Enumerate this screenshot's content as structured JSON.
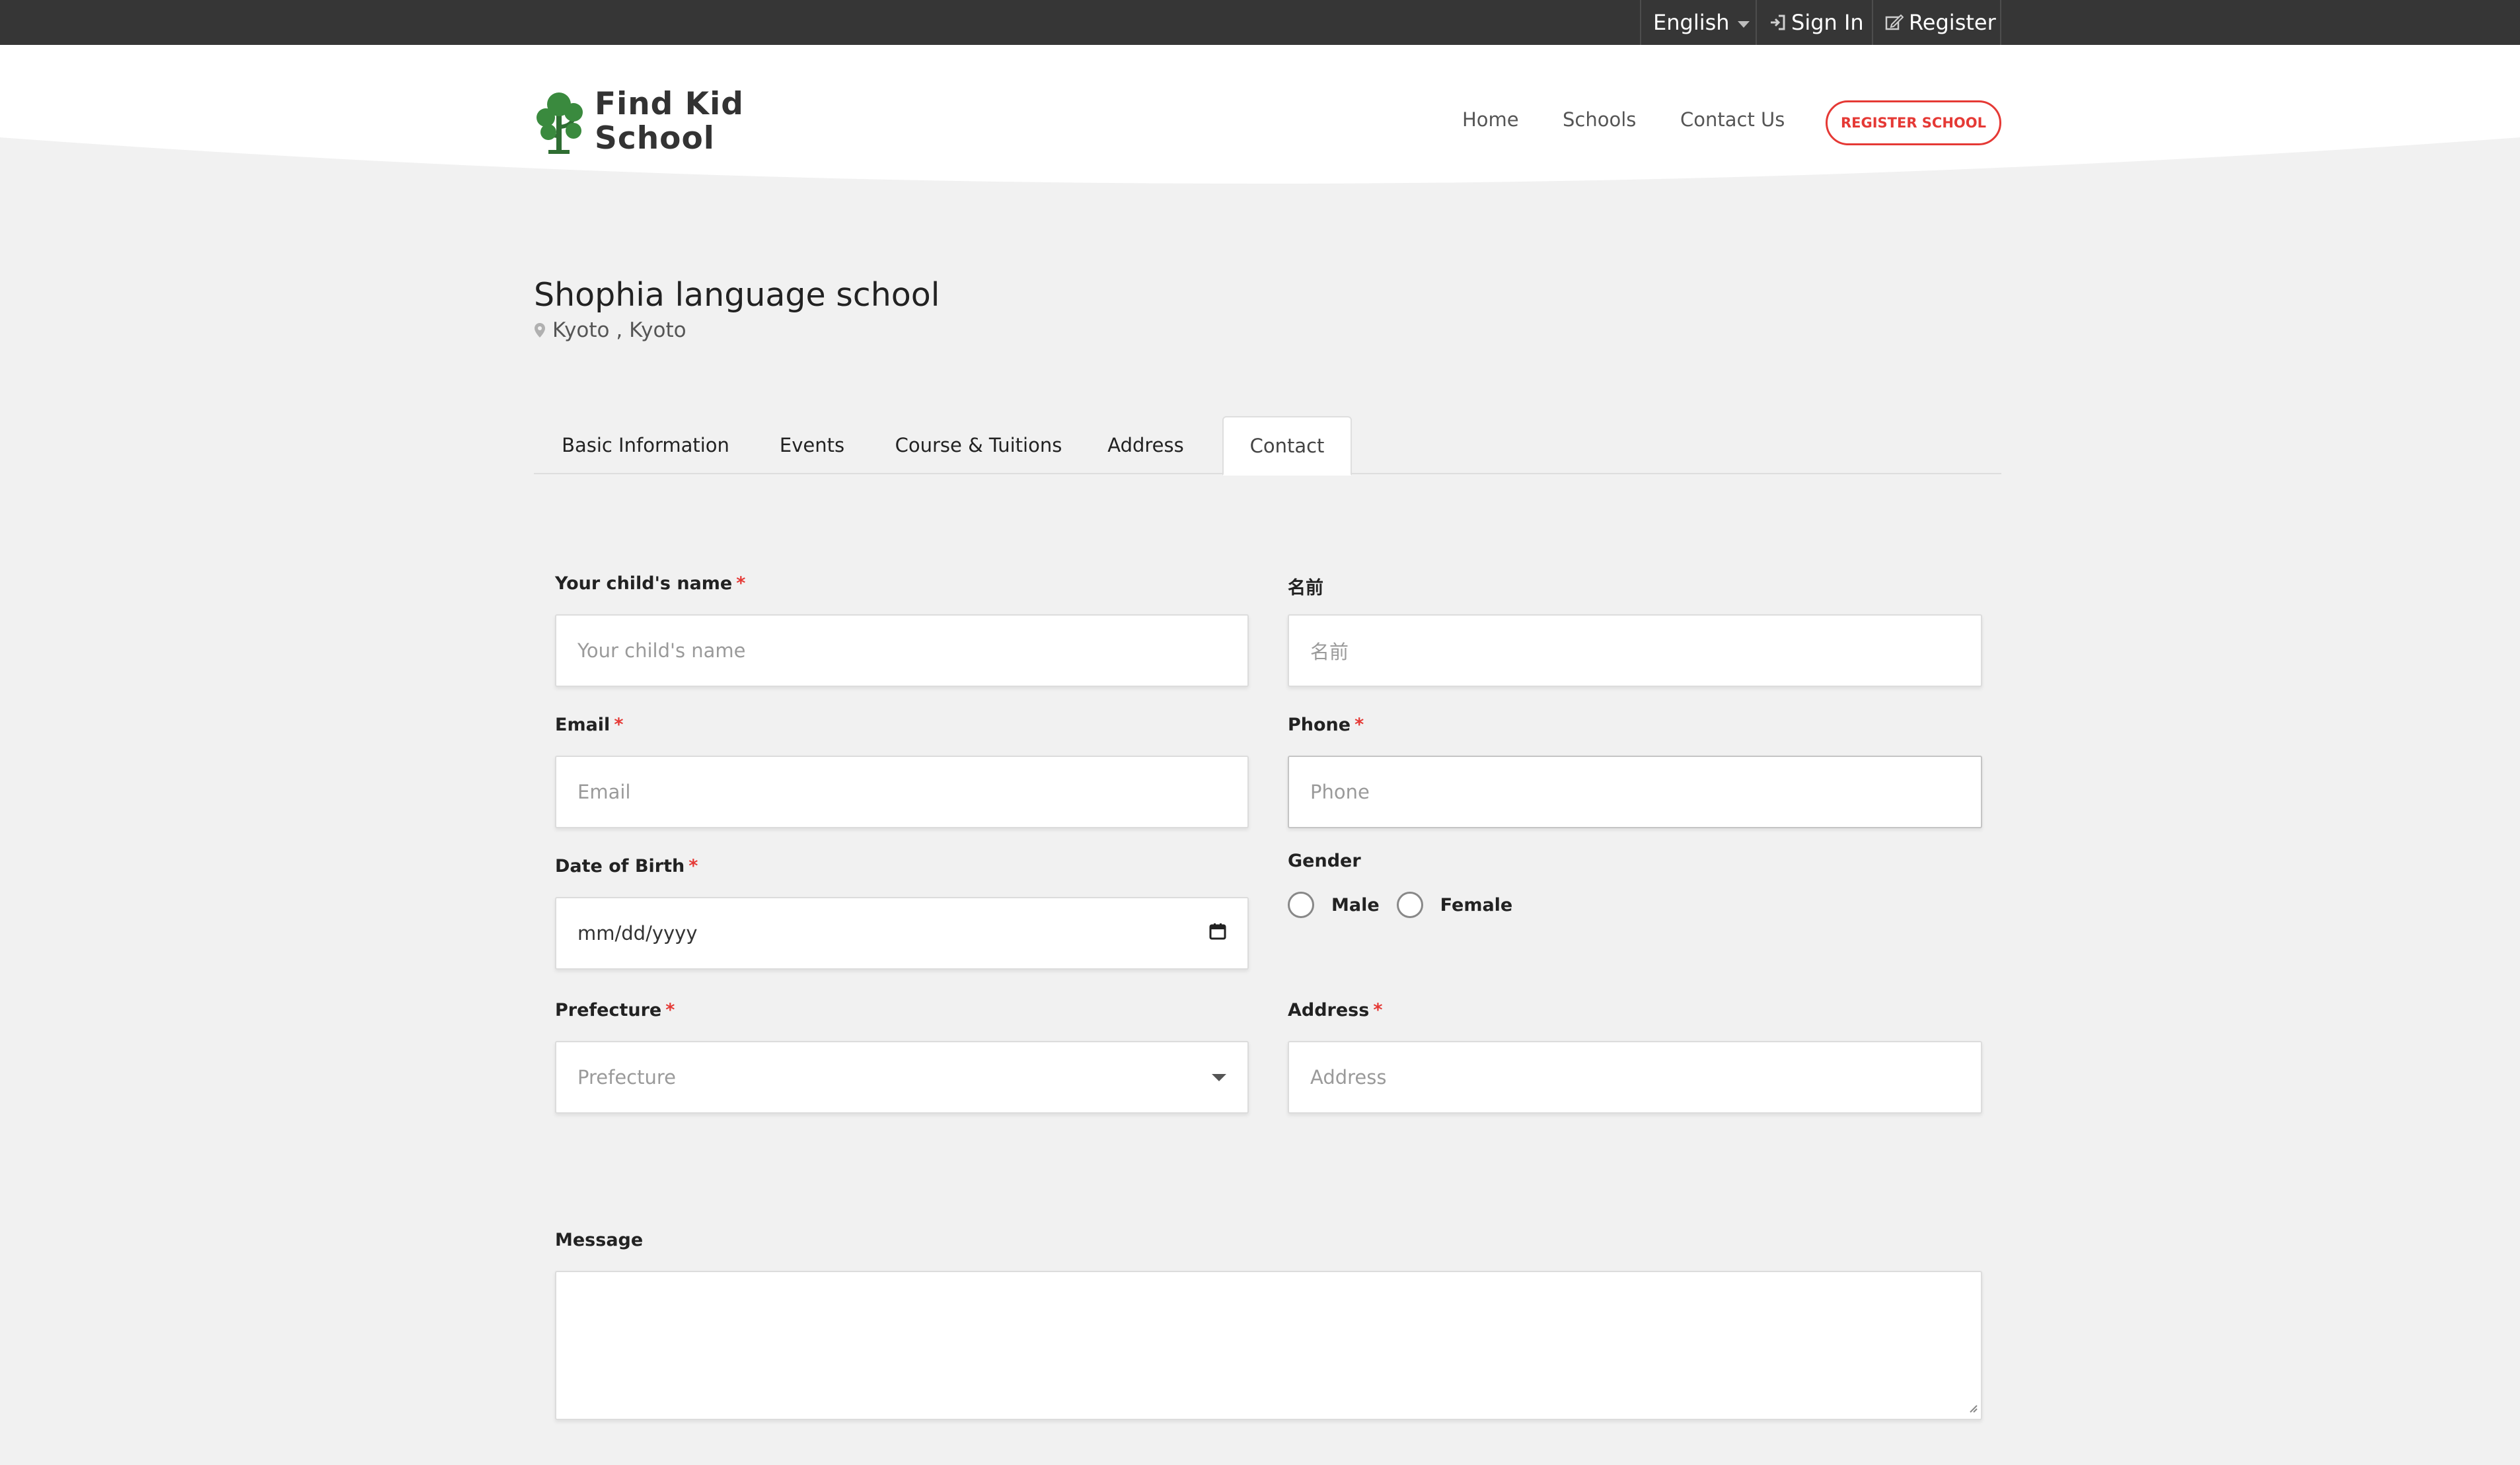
{
  "topbar": {
    "language": "English",
    "sign_in": "Sign In",
    "register": "Register"
  },
  "header": {
    "logo_line1": "Find Kid",
    "logo_line2": "School",
    "nav": [
      "Home",
      "Schools",
      "Contact Us"
    ],
    "register_school": "REGISTER SCHOOL"
  },
  "school": {
    "name": "Shophia language school",
    "location": "Kyoto , Kyoto"
  },
  "tabs": [
    {
      "label": "Basic Information",
      "active": false
    },
    {
      "label": "Events",
      "active": false
    },
    {
      "label": "Course & Tuitions",
      "active": false
    },
    {
      "label": "Address",
      "active": false
    },
    {
      "label": "Contact",
      "active": true
    }
  ],
  "form": {
    "child_name": {
      "label": "Your child's name",
      "required": "*",
      "placeholder": "Your child's name"
    },
    "name_jp": {
      "label": "名前",
      "placeholder": "名前"
    },
    "email": {
      "label": "Email",
      "required": "*",
      "placeholder": "Email"
    },
    "phone": {
      "label": "Phone",
      "required": "*",
      "placeholder": "Phone"
    },
    "dob": {
      "label": "Date of Birth",
      "required": "*",
      "value": "mm/dd/yyyy"
    },
    "gender": {
      "label": "Gender",
      "options": [
        "Male",
        "Female"
      ]
    },
    "prefecture": {
      "label": "Prefecture",
      "required": "*",
      "placeholder": "Prefecture"
    },
    "address": {
      "label": "Address",
      "required": "*",
      "placeholder": "Address"
    },
    "message": {
      "label": "Message"
    }
  },
  "colors": {
    "topbar": "#363636",
    "accent_red": "#e53935",
    "logo_green": "#3a8a3e",
    "page_bg": "#f1f1f1"
  },
  "icons": {
    "language_caret": "caret-down-icon",
    "sign_in": "sign-in-icon",
    "register": "edit-icon",
    "location": "map-pin-icon",
    "calendar": "calendar-icon",
    "select": "chevron-down-icon"
  }
}
